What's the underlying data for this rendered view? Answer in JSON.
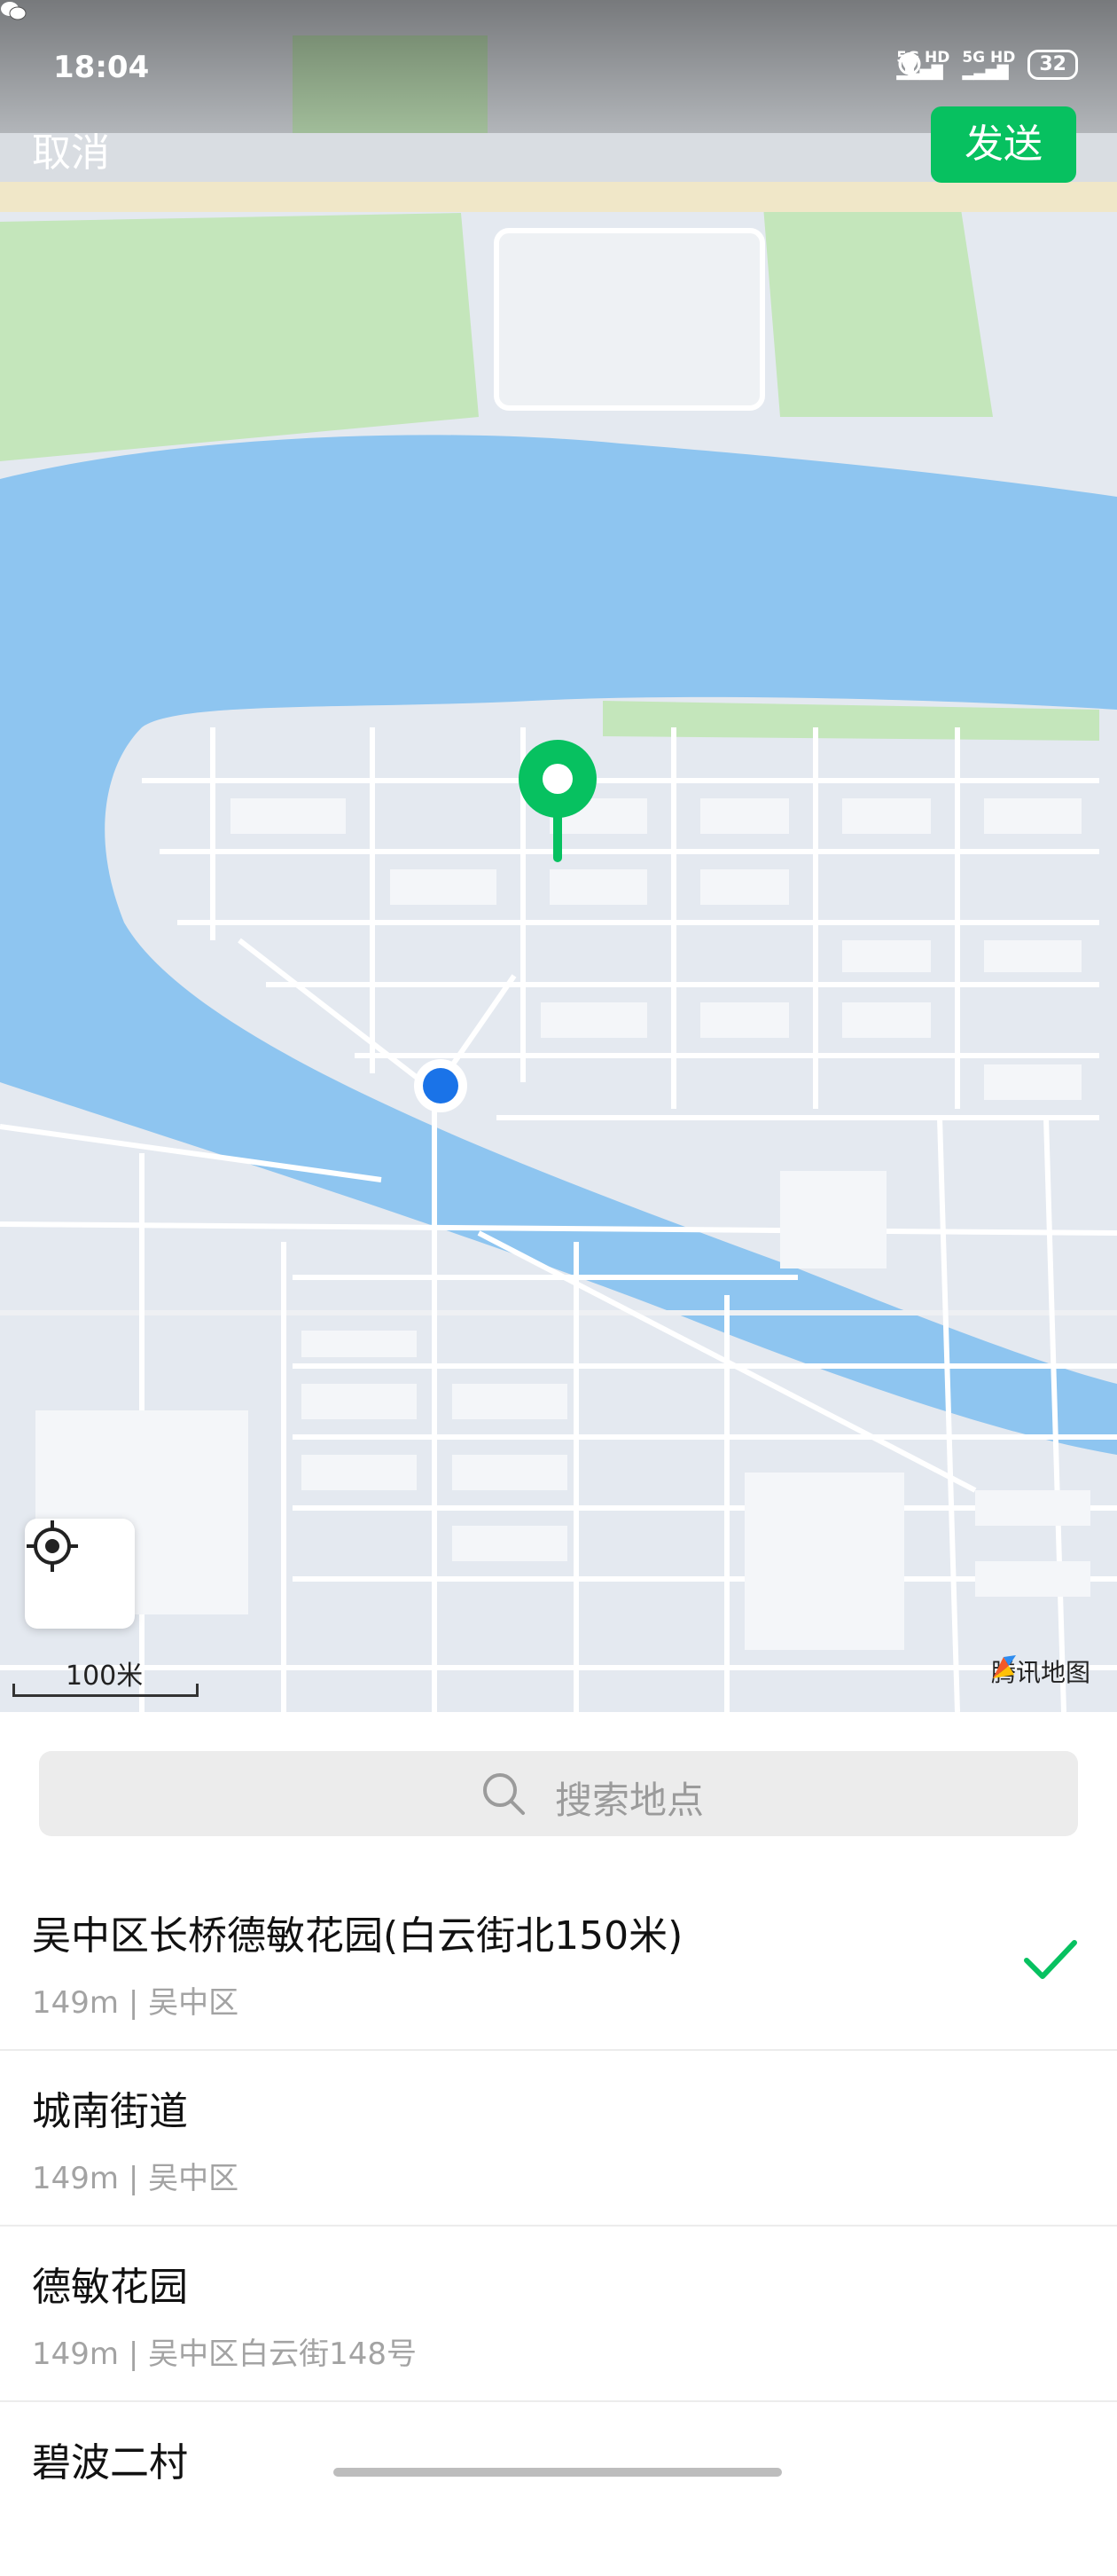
{
  "status_bar": {
    "time": "18:04",
    "signal_1": "5G HD",
    "signal_2": "5G HD",
    "battery": "32",
    "icons": [
      "wechat-icon",
      "alarm-icon",
      "location-icon",
      "vibrate-icon"
    ]
  },
  "top_bar": {
    "cancel_label": "取消",
    "send_label": "发送"
  },
  "map": {
    "scale_label": "100米",
    "brand": "腾讯地图",
    "colors": {
      "water": "#8ec5f0",
      "park": "#bfe5b6",
      "land": "#e3e8ef",
      "road": "#ffffff",
      "pin": "#07c160",
      "user_dot": "#1a73e8"
    }
  },
  "search": {
    "placeholder": "搜索地点"
  },
  "results": [
    {
      "title": "吴中区长桥德敏花园(白云街北150米)",
      "subtitle": "149m | 吴中区",
      "selected": true
    },
    {
      "title": "城南街道",
      "subtitle": "149m | 吴中区",
      "selected": false
    },
    {
      "title": "德敏花园",
      "subtitle": "149m | 吴中区白云街148号",
      "selected": false
    },
    {
      "title": "碧波二村",
      "subtitle": "",
      "selected": false
    }
  ],
  "accent_color": "#07c160"
}
